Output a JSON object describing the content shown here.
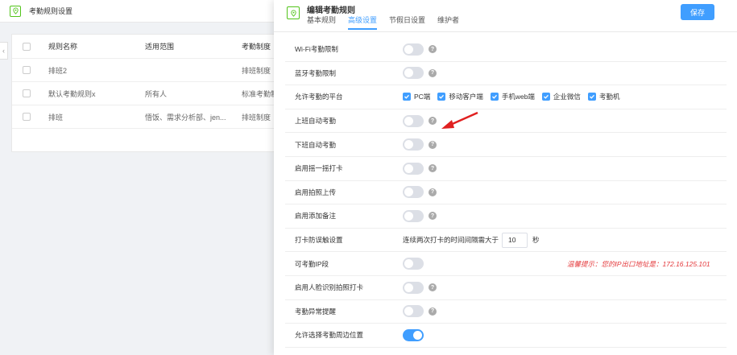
{
  "background": {
    "title": "考勤规则设置",
    "collapse_glyph": "‹",
    "table": {
      "headers": [
        "规则名称",
        "适用范围",
        "考勤制度"
      ],
      "rows": [
        {
          "name": "排班2",
          "scope": "",
          "system": "排班制度"
        },
        {
          "name": "默认考勤规则x",
          "scope": "所有人",
          "system": "标准考勤制"
        },
        {
          "name": "排班",
          "scope": "悟饭、需求分析部、jen...",
          "system": "排班制度"
        }
      ]
    }
  },
  "panel": {
    "title": "编辑考勤规则",
    "save_label": "保存",
    "tabs": [
      {
        "label": "基本规则",
        "active": false
      },
      {
        "label": "高级设置",
        "active": true
      },
      {
        "label": "节假日设置",
        "active": false
      },
      {
        "label": "维护者",
        "active": false
      }
    ],
    "settings": [
      {
        "label": "Wi-Fi考勤限制",
        "type": "switch",
        "on": false,
        "help": true
      },
      {
        "label": "蓝牙考勤限制",
        "type": "switch",
        "on": false,
        "help": true
      },
      {
        "label": "允许考勤的平台",
        "type": "platforms",
        "options": [
          {
            "label": "PC端",
            "checked": true
          },
          {
            "label": "移动客户端",
            "checked": true
          },
          {
            "label": "手机web端",
            "checked": true
          },
          {
            "label": "企业微信",
            "checked": true
          },
          {
            "label": "考勤机",
            "checked": true
          }
        ]
      },
      {
        "label": "上班自动考勤",
        "type": "switch",
        "on": false,
        "help": true
      },
      {
        "label": "下班自动考勤",
        "type": "switch",
        "on": false,
        "help": true
      },
      {
        "label": "启用摇一摇打卡",
        "type": "switch",
        "on": false,
        "help": true
      },
      {
        "label": "启用拍照上传",
        "type": "switch",
        "on": false,
        "help": true
      },
      {
        "label": "启用添加备注",
        "type": "switch",
        "on": false,
        "help": true
      },
      {
        "label": "打卡防误触设置",
        "type": "interval",
        "prefix": "连续两次打卡的时间间隔需大于",
        "value": "10",
        "unit": "秒"
      },
      {
        "label": "可考勤IP段",
        "type": "switch",
        "on": false,
        "help": false,
        "tip": "温馨提示：您的IP出口地址是：172.16.125.101"
      },
      {
        "label": "启用人脸识别拍照打卡",
        "type": "switch",
        "on": false,
        "help": true
      },
      {
        "label": "考勤异常提醒",
        "type": "switch",
        "on": false,
        "help": true
      },
      {
        "label": "允许选择考勤周边位置",
        "type": "switch",
        "on": true,
        "help": false
      }
    ],
    "help_glyph": "?"
  },
  "colors": {
    "accent": "#409eff",
    "arrow": "#e02020",
    "tip": "#e4393c",
    "icon": "#52c41a"
  }
}
